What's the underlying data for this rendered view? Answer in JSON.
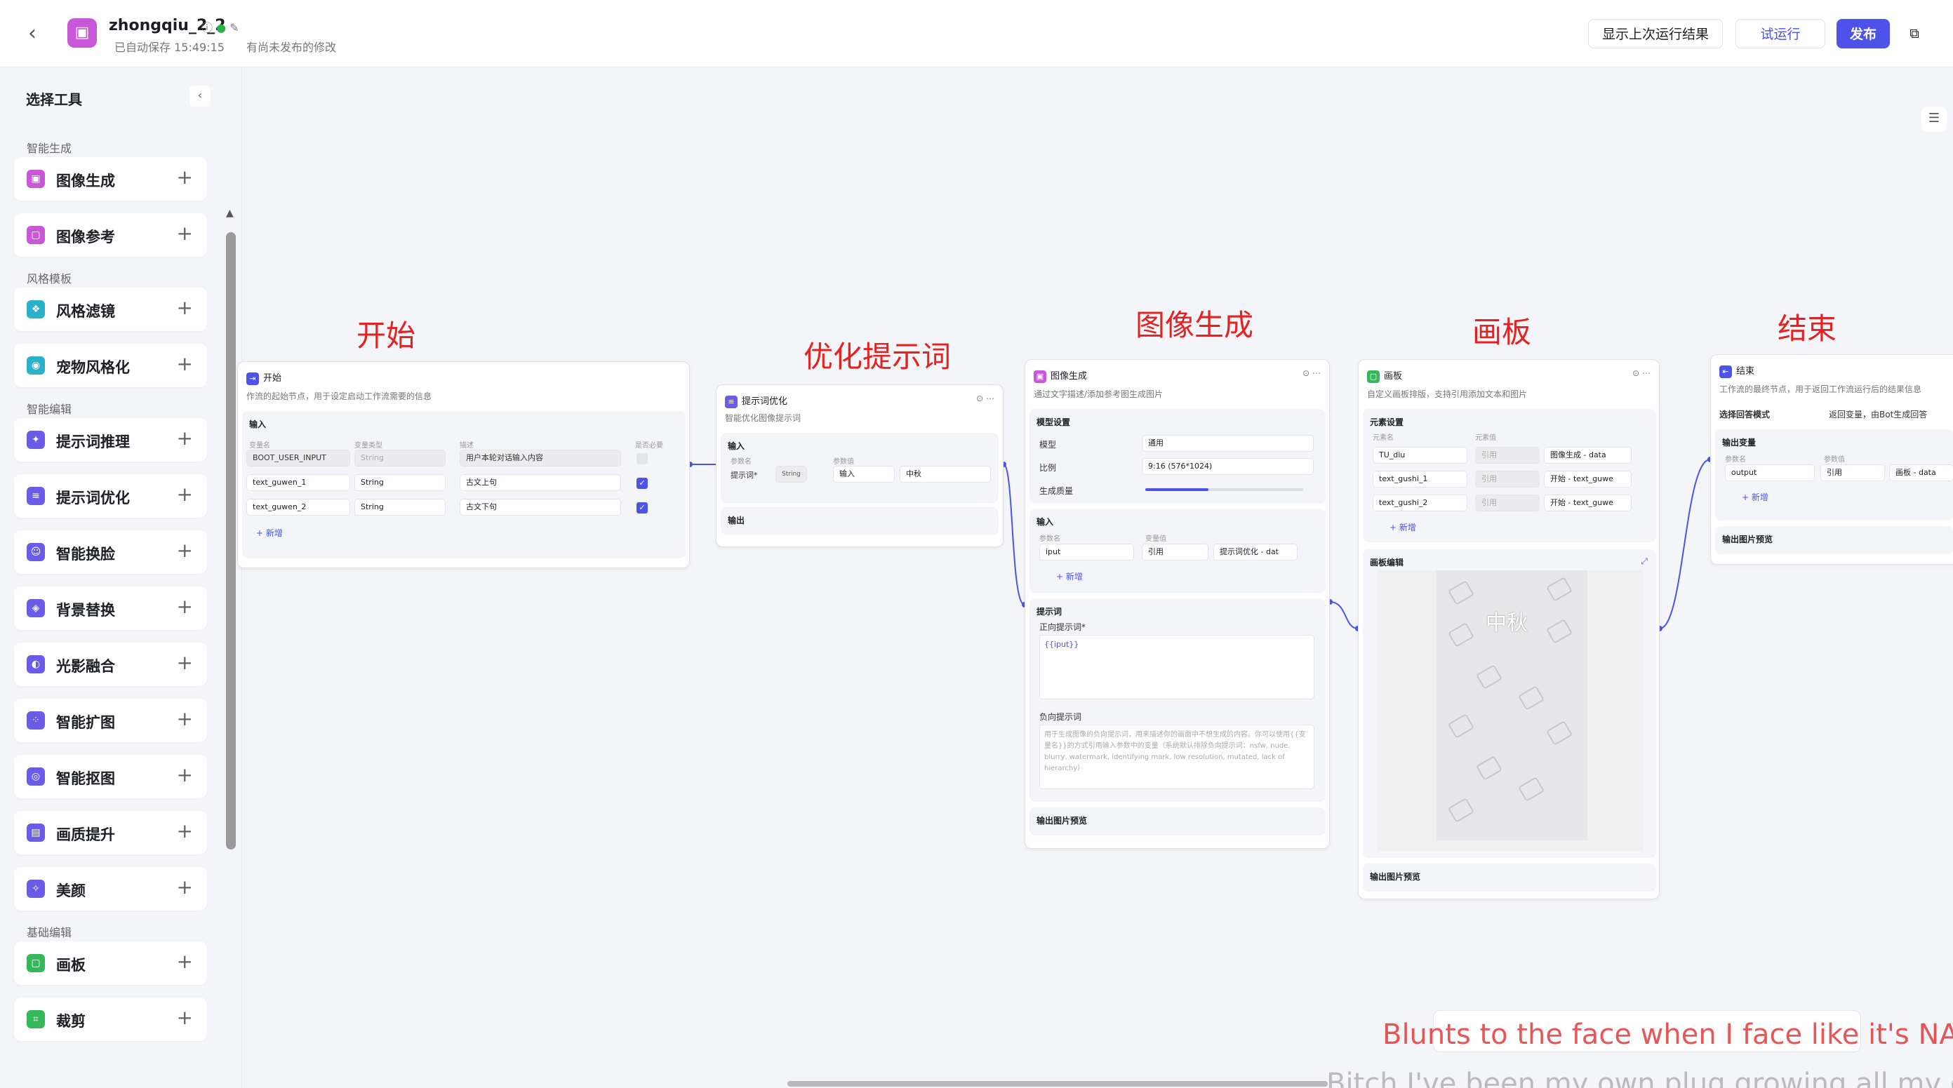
{
  "header": {
    "title": "zhongqiu_2_2",
    "autosave": "已自动保存 15:49:15",
    "unpublished": "有尚未发布的修改",
    "show_last_run": "显示上次运行结果",
    "trial_run": "试运行",
    "publish": "发布",
    "app_icon": "app-icon"
  },
  "sidebar": {
    "title": "选择工具",
    "groups": [
      {
        "label": "智能生成",
        "items": [
          "图像生成",
          "图像参考"
        ]
      },
      {
        "label": "风格模板",
        "items": [
          "风格滤镜",
          "宠物风格化"
        ]
      },
      {
        "label": "智能编辑",
        "items": [
          "提示词推理",
          "提示词优化",
          "智能换脸",
          "背景替换",
          "光影融合",
          "智能扩图",
          "智能抠图",
          "画质提升",
          "美颜"
        ]
      },
      {
        "label": "基础编辑",
        "items": [
          "画板",
          "裁剪"
        ]
      }
    ],
    "icon_colors": [
      "#c858d8",
      "#c858d8",
      "#2ab0c8",
      "#2ab0c8",
      "#6b5ce8",
      "#6b5ce8",
      "#6b5ce8",
      "#6b5ce8",
      "#6b5ce8",
      "#6b5ce8",
      "#6b5ce8",
      "#6b5ce8",
      "#6b5ce8",
      "#34b85a",
      "#34b85a"
    ]
  },
  "annotations": {
    "start": "开始",
    "optimize": "优化提示词",
    "imagegen": "图像生成",
    "board": "画板",
    "end": "结束"
  },
  "node_start": {
    "title": "开始",
    "desc": "作流的起始节点，用于设定启动工作流需要的信息",
    "input_label": "输入",
    "col_name": "变量名",
    "col_type": "变量类型",
    "col_desc": "描述",
    "col_req": "是否必要",
    "rows": [
      {
        "name": "BOOT_USER_INPUT",
        "type": "String",
        "desc": "用户本轮对话输入内容"
      },
      {
        "name": "text_guwen_1",
        "type": "String",
        "desc": "古文上句"
      },
      {
        "name": "text_guwen_2",
        "type": "String",
        "desc": "古文下句"
      }
    ],
    "add": "+ 新增"
  },
  "node_opt": {
    "title": "提示词优化",
    "desc": "智能优化图像提示词",
    "input_label": "输入",
    "col_name": "参数名",
    "col_value": "参数值",
    "param": "提示词*",
    "param_type": "String",
    "mode": "输入",
    "value": "中秋",
    "output_label": "输出"
  },
  "node_img": {
    "title": "图像生成",
    "desc": "通过文字描述/添加参考图生成图片",
    "model_settings": "模型设置",
    "model_label": "模型",
    "model_value": "通用",
    "ratio_label": "比例",
    "ratio_value": "9:16 (576*1024)",
    "quality_label": "生成质量",
    "quality_value": 0.4,
    "input_label": "输入",
    "col_name": "参数名",
    "col_value": "变量值",
    "in_name": "iput",
    "in_mode": "引用",
    "in_ref": "提示词优化 - dat",
    "add": "+ 新增",
    "prompt_section": "提示词",
    "pos_label": "正向提示词*",
    "pos_value": "{{iput}}",
    "neg_label": "负向提示词",
    "neg_placeholder": "用于生成图像的负向提示词，用来描述你的画面中不想生成的内容。你可以使用{{变量名}}的方式引用输入参数中的变量（系统默认排除负向提示词：nsfw, nude, blurry, watermark, identifying mark, low resolution, mutated, lack of hierarchy）",
    "output_preview": "输出图片预览"
  },
  "node_board": {
    "title": "画板",
    "desc": "自定义画板排版，支持引用添加文本和图片",
    "elements_label": "元素设置",
    "col_name": "元素名",
    "col_value": "元素值",
    "rows": [
      {
        "name": "TU_diu",
        "mode": "引用",
        "ref": "图像生成 - data"
      },
      {
        "name": "text_gushi_1",
        "mode": "引用",
        "ref": "开始 - text_guwe"
      },
      {
        "name": "text_gushi_2",
        "mode": "引用",
        "ref": "开始 - text_guwe"
      }
    ],
    "add": "+ 新增",
    "edit_label": "画板编辑",
    "canvas_text": "中秋",
    "output_preview": "输出图片预览"
  },
  "node_end": {
    "title": "结束",
    "desc": "工作流的最终节点，用于返回工作流运行后的结果信息",
    "mode_label": "选择回答模式",
    "mode_value": "返回变量，由Bot生成回答",
    "output_var": "输出变量",
    "col_name": "参数名",
    "col_value": "参数值",
    "out_name": "output",
    "out_mode": "引用",
    "out_ref": "画板 - data",
    "add": "+ 新增",
    "output_preview": "输出图片预览"
  },
  "overlay": {
    "caption1": "Blunts to the face when I face like it's NASC",
    "caption2": "Bitch I've been my own plug growing all my ow"
  }
}
